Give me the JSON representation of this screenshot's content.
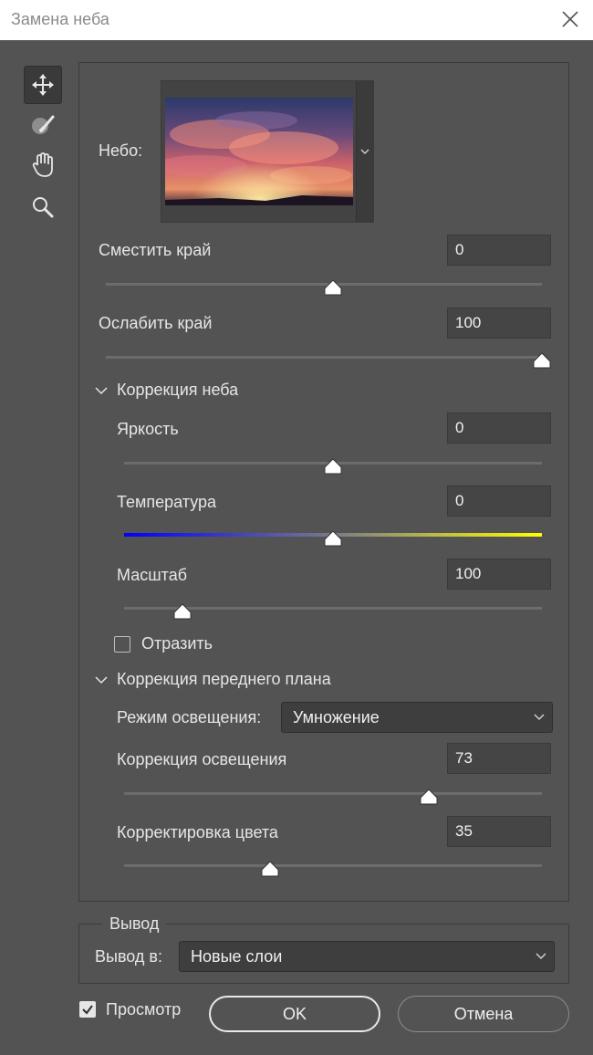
{
  "window": {
    "title": "Замена неба"
  },
  "tools": [
    {
      "name": "move-tool",
      "icon": "move-icon"
    },
    {
      "name": "sky-brush-tool",
      "icon": "sky-brush-icon"
    },
    {
      "name": "hand-tool",
      "icon": "hand-icon"
    },
    {
      "name": "zoom-tool",
      "icon": "zoom-icon"
    }
  ],
  "sky": {
    "label": "Небо:",
    "preset": "sunset-clouds-thumbnail"
  },
  "shift_edge": {
    "label": "Сместить край",
    "value": "0",
    "fraction": 0.52
  },
  "fade_edge": {
    "label": "Ослабить край",
    "value": "100",
    "fraction": 1.0
  },
  "sky_adjust": {
    "heading": "Коррекция неба",
    "brightness": {
      "label": "Яркость",
      "value": "0",
      "fraction": 0.5
    },
    "temperature": {
      "label": "Температура",
      "value": "0",
      "fraction": 0.5
    },
    "scale": {
      "label": "Масштаб",
      "value": "100",
      "fraction": 0.14
    },
    "flip": {
      "label": "Отразить",
      "checked": false
    }
  },
  "fg_adjust": {
    "heading": "Коррекция переднего плана",
    "light_mode": {
      "label": "Режим освещения:",
      "selected": "Умножение"
    },
    "lighting": {
      "label": "Коррекция освещения",
      "value": "73",
      "fraction": 0.73
    },
    "color": {
      "label": "Корректировка цвета",
      "value": "35",
      "fraction": 0.35
    }
  },
  "output": {
    "legend": "Вывод",
    "label": "Вывод в:",
    "selected": "Новые слои"
  },
  "preview": {
    "label": "Просмотр",
    "checked": true
  },
  "buttons": {
    "ok": "OK",
    "cancel": "Отмена"
  },
  "colors": {
    "background": "#535353",
    "titlebar": "#ffffff",
    "field": "#454545",
    "temp_cold": "#0000ff",
    "temp_warm": "#ffff00"
  }
}
